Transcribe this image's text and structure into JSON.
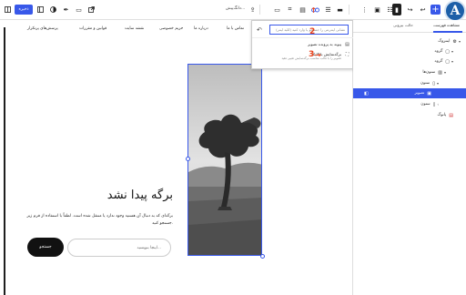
{
  "toolbar": {
    "save_label": "ذخیره",
    "template_label": "دانگ‌پیش...",
    "add_icon_glyph": "+"
  },
  "annotations": {
    "step1": "1",
    "step2": "2",
    "step3": "3"
  },
  "nav_menu": [
    "تماس با ما",
    "درباره ما",
    "حریم خصوصی",
    "نقشه سایت",
    "قوانین و مقررات",
    "پرسش‌های پرتکرار"
  ],
  "not_found": {
    "title": "برگه پیدا نشد",
    "description": "برگه‌ای که به دنبال آن هستید وجود ندارد یا منتقل شده است. لطفاً با استفاده از فرم زیر جستجو کنید.",
    "search_placeholder": "اینجا بنویسید...",
    "search_button": "جستجو"
  },
  "popover": {
    "search_value": "نشانی اینترنتی را جستجو یا وارد کنید (کلید اینتر)",
    "items": [
      {
        "label": "پیوند به پرونده تصویر",
        "description": ""
      },
      {
        "label": "برگه‌نمایش با کلیک",
        "description": "تصویر را با قالب مناسب برگه‌نمایش تغییر دهید"
      }
    ]
  },
  "sidebar": {
    "tabs": [
      "مشاهده فهرست",
      "حالت بیرونی"
    ],
    "tree": [
      {
        "label": "اینتروگ",
        "icon": "gear-icon",
        "depth": 0,
        "selected": false
      },
      {
        "label": "گروه",
        "icon": "group-icon",
        "depth": 1,
        "selected": false
      },
      {
        "label": "گروه",
        "icon": "group-icon",
        "depth": 1,
        "selected": false
      },
      {
        "label": "ستون‌ها",
        "icon": "columns-icon",
        "depth": 2,
        "selected": false
      },
      {
        "label": "ستون",
        "icon": "column-icon",
        "depth": 3,
        "selected": false
      },
      {
        "label": "تصویر",
        "icon": "image-icon",
        "depth": 4,
        "selected": true
      },
      {
        "label": "ستون",
        "icon": "column-icon",
        "depth": 3,
        "selected": false
      },
      {
        "label": "پانوگ",
        "icon": "footer-icon",
        "depth": 0,
        "selected": false
      }
    ]
  },
  "colors": {
    "accent": "#3858e9",
    "annotation": "#e8421b",
    "dark": "#1e1e1e"
  }
}
